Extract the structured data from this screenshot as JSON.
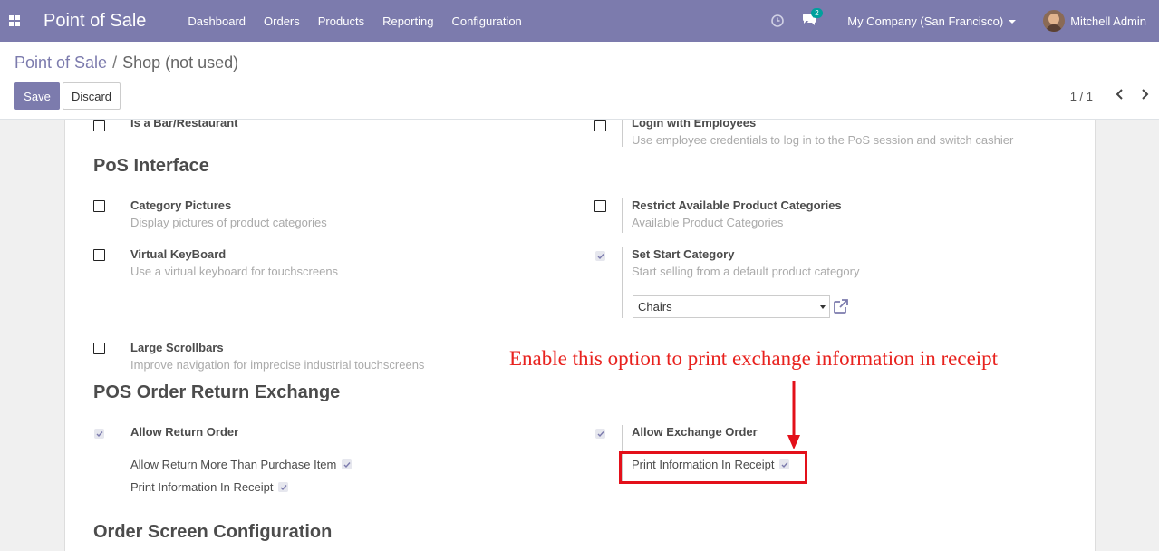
{
  "navbar": {
    "app_title": "Point of Sale",
    "menu": [
      "Dashboard",
      "Orders",
      "Products",
      "Reporting",
      "Configuration"
    ],
    "chat_badge": "2",
    "company": "My Company (San Francisco)",
    "user": "Mitchell Admin",
    "color": "#7c7bad"
  },
  "breadcrumb": {
    "parent": "Point of Sale",
    "separator": "/",
    "current": "Shop (not used)"
  },
  "buttons": {
    "save": "Save",
    "discard": "Discard"
  },
  "pager": {
    "value": "1 / 1"
  },
  "settings_top": {
    "bar_restaurant": {
      "label": "Is a Bar/Restaurant",
      "checked": false
    },
    "login_employees": {
      "label": "Login with Employees",
      "help": "Use employee credentials to log in to the PoS session and switch cashier",
      "checked": false
    }
  },
  "pos_interface": {
    "title": "PoS Interface",
    "category_pictures": {
      "label": "Category Pictures",
      "help": "Display pictures of product categories",
      "checked": false
    },
    "restrict_categories": {
      "label": "Restrict Available Product Categories",
      "help": "Available Product Categories",
      "checked": false
    },
    "virtual_keyboard": {
      "label": "Virtual KeyBoard",
      "help": "Use a virtual keyboard for touchscreens",
      "checked": false
    },
    "start_category": {
      "label": "Set Start Category",
      "help": "Start selling from a default product category",
      "checked": true,
      "value": "Chairs"
    },
    "large_scrollbars": {
      "label": "Large Scrollbars",
      "help": "Improve navigation for imprecise industrial touchscreens",
      "checked": false
    }
  },
  "return_exchange": {
    "title": "POS Order Return Exchange",
    "allow_return": {
      "label": "Allow Return Order",
      "checked": true
    },
    "return_more": {
      "label": "Allow Return More Than Purchase Item",
      "checked": true
    },
    "return_print": {
      "label": "Print Information In Receipt",
      "checked": true
    },
    "allow_exchange": {
      "label": "Allow Exchange Order",
      "checked": true
    },
    "exchange_print": {
      "label": "Print Information In Receipt",
      "checked": true
    }
  },
  "order_screen": {
    "title": "Order Screen Configuration"
  },
  "annotation": {
    "text": "Enable this option to print exchange information in receipt",
    "color": "#e8221e"
  }
}
